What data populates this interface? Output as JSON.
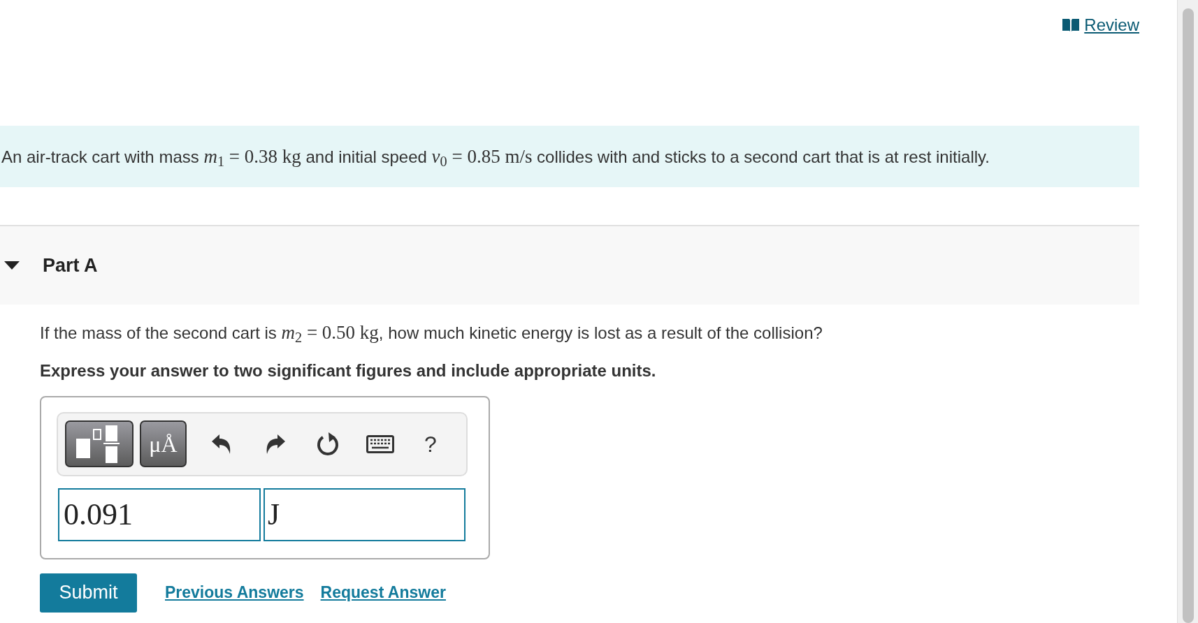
{
  "review_link": "Review",
  "intro": [
    {
      "kind": "text",
      "s": "An air-track cart with mass "
    },
    {
      "kind": "math",
      "s": "*m*$_{1}$ = 0.38 kg"
    },
    {
      "kind": "text",
      "s": " and initial speed "
    },
    {
      "kind": "math",
      "s": "*v*$_{0}$ = 0.85 m/s"
    },
    {
      "kind": "text",
      "s": " collides with and sticks to a second cart that is at rest initially."
    }
  ],
  "part": {
    "title": "Part A",
    "expanded": true
  },
  "question": [
    {
      "kind": "text",
      "s": "If the mass of the second cart is "
    },
    {
      "kind": "math",
      "s": "*m*$_{2}$ = 0.50 kg"
    },
    {
      "kind": "text",
      "s": ", how much kinetic energy is lost as a result of the collision?"
    }
  ],
  "instruction": "Express your answer to two significant figures and include appropriate units.",
  "toolbar": {
    "units_button": "μÅ",
    "help_button": "?"
  },
  "answer": {
    "value": "0.091",
    "units": "J"
  },
  "submit_button": "Submit",
  "links": [
    "Previous Answers",
    "Request Answer"
  ]
}
